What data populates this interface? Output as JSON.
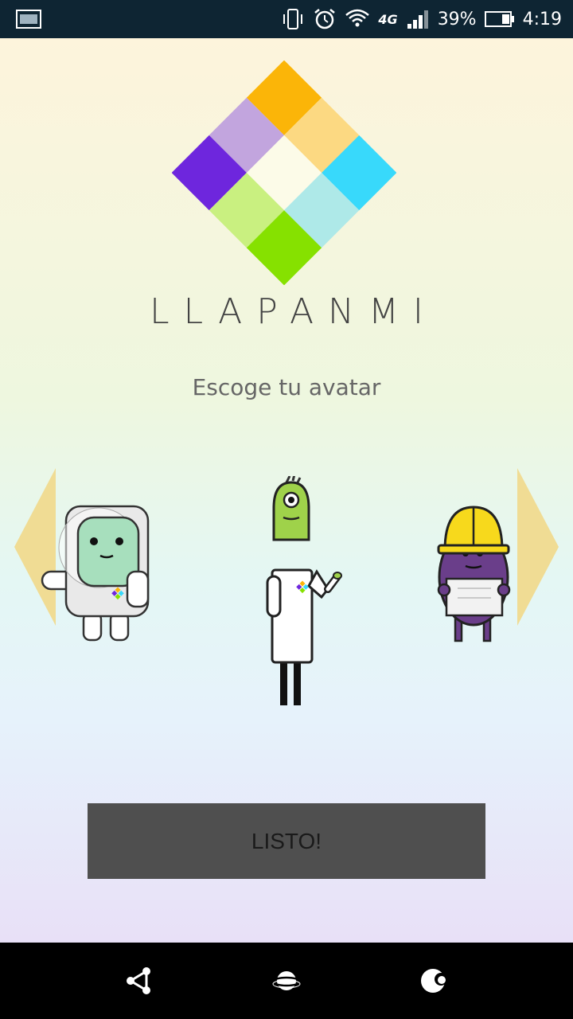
{
  "status_bar": {
    "battery_percent": "39%",
    "time": "4:19",
    "network": "4G",
    "icons": [
      "screenshot-icon",
      "vibrate-icon",
      "alarm-icon",
      "wifi-icon",
      "signal-icon",
      "battery-icon"
    ]
  },
  "app": {
    "brand_name": "LLAPANMI",
    "subtitle": "Escoge tu avatar",
    "avatars": [
      "astronaut-avatar",
      "scientist-avatar",
      "construction-worker-avatar"
    ],
    "done_button": "LISTO!"
  },
  "colors": {
    "logo_top": "#38d9fb",
    "logo_left": "#fbb508",
    "logo_right": "#86e100",
    "logo_bottom": "#6e26dd",
    "arrow": "#f0dc94",
    "button_bg": "#4f4f4f"
  },
  "nav_bar": {
    "icons": [
      "share-icon",
      "planet-icon",
      "moon-icon"
    ]
  }
}
